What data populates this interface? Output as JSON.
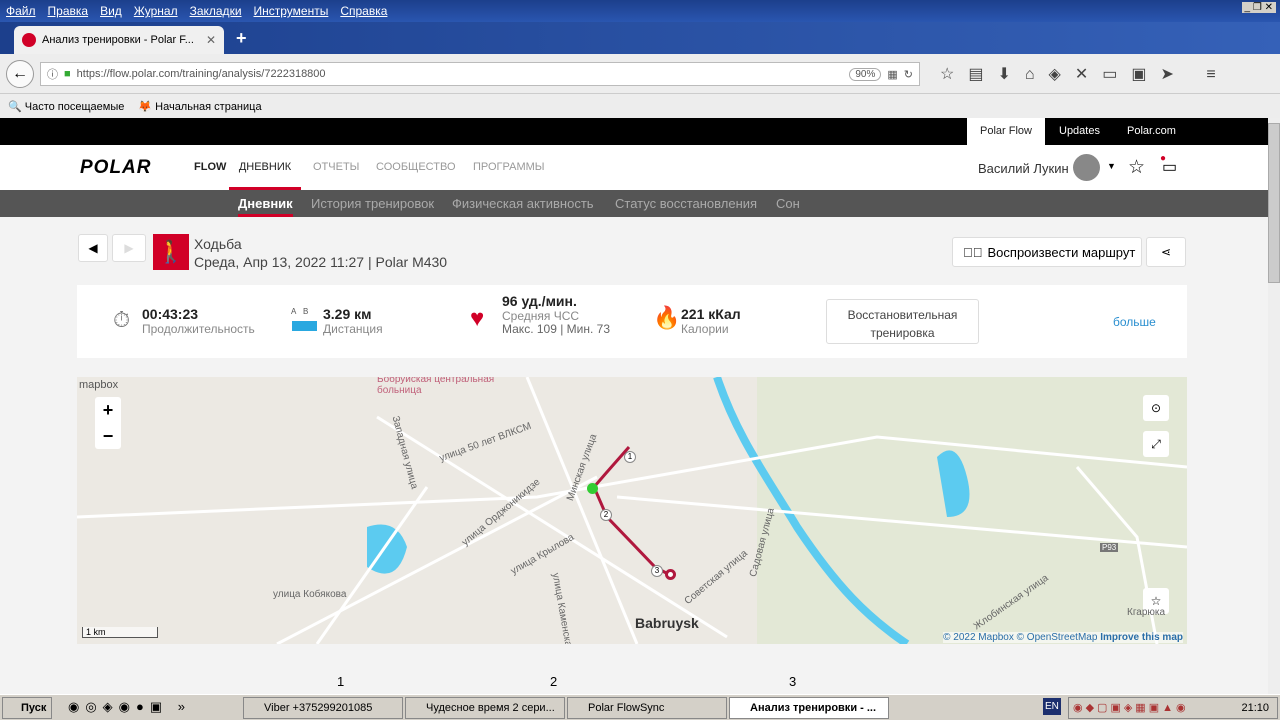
{
  "browser": {
    "menu": [
      "Файл",
      "Правка",
      "Вид",
      "Журнал",
      "Закладки",
      "Инструменты",
      "Справка"
    ],
    "tab_title": "Анализ тренировки - Polar F...",
    "url": "https://flow.polar.com/training/analysis/7222318800",
    "zoom": "90%",
    "bookmarks": [
      "Часто посещаемые",
      "Начальная страница"
    ]
  },
  "top_links": [
    "Polar Flow",
    "Updates",
    "Polar.com"
  ],
  "header": {
    "logo": "POLAR",
    "flow": "FLOW",
    "nav": [
      "ДНЕВНИК",
      "ОТЧЕТЫ",
      "СООБЩЕСТВО",
      "ПРОГРАММЫ"
    ],
    "user": "Василий Лукин"
  },
  "subnav": [
    "Дневник",
    "История тренировок",
    "Физическая активность",
    "Статус восстановления",
    "Сон"
  ],
  "training": {
    "sport": "Ходьба",
    "datetime": "Среда, Апр 13, 2022 11:27 | Polar M430",
    "replay": "Воспроизвести маршрут"
  },
  "stats": {
    "duration": {
      "value": "00:43:23",
      "label": "Продолжительность"
    },
    "distance": {
      "value": "3.29 км",
      "label": "Дистанция",
      "a": "A",
      "b": "B"
    },
    "hr": {
      "value": "96 уд./мин.",
      "label": "Средняя ЧСС",
      "minmax": "Макс. 109  |  Мин. 73"
    },
    "calories": {
      "value": "221 кКал",
      "label": "Калории"
    },
    "benefit": "Восстановительная тренировка",
    "more": "больше"
  },
  "map": {
    "labels": [
      "Бобруйская центральная больница",
      "улица 50 лет ВЛКСМ",
      "Западная улица",
      "Минская улица",
      "улица Орджоникидзе",
      "улица Крылова",
      "улица Кобякова",
      "Садовая улица",
      "Советская улица",
      "улица Каменская",
      "Babruysk",
      "Жлобинская улица",
      "Кгарюка",
      "P93"
    ],
    "markers": [
      "1",
      "2",
      "3"
    ],
    "scale": "1 km",
    "attribution": [
      "© 2022 Mapbox",
      "© OpenStreetMap",
      "Improve this map"
    ],
    "mapbox": "mapbox",
    "route_color": "#b0183e"
  },
  "page_markers": [
    "1",
    "2",
    "3"
  ],
  "taskbar": {
    "start": "Пуск",
    "items": [
      "Viber +375299201085",
      "Чудесное время 2 сери...",
      "Polar FlowSync",
      "Анализ тренировки - ..."
    ],
    "lang": "EN",
    "clock": "21:10"
  },
  "colors": {
    "accent": "#d10027",
    "water": "#5ccbf0"
  }
}
